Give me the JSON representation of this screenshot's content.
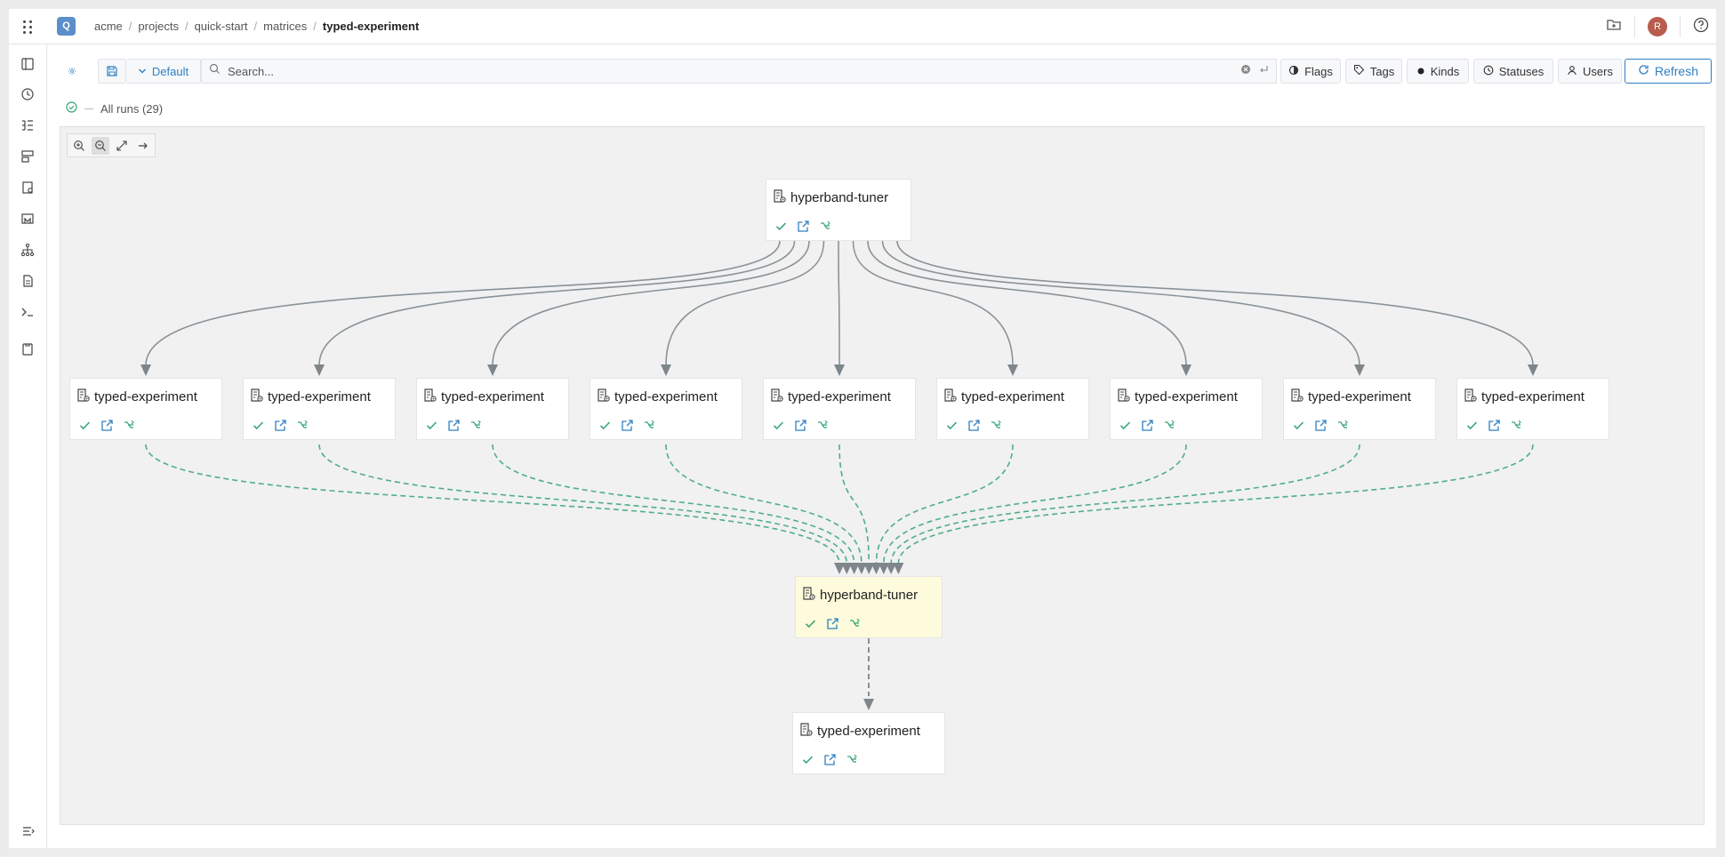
{
  "topbar": {
    "logo_letter": "Q",
    "avatar_letter": "R",
    "breadcrumb": [
      "acme",
      "projects",
      "quick-start",
      "matrices",
      "typed-experiment"
    ]
  },
  "toolbar": {
    "preset_label": "Default",
    "search_placeholder": "Search...",
    "filters": [
      "Flags",
      "Tags",
      "Kinds",
      "Statuses",
      "Users"
    ],
    "refresh_label": "Refresh"
  },
  "runs": {
    "label": "All runs (29)"
  },
  "graph": {
    "parent": {
      "name": "hyperband-tuner",
      "status": "succeeded"
    },
    "children": [
      {
        "name": "typed-experiment",
        "status": "succeeded"
      },
      {
        "name": "typed-experiment",
        "status": "succeeded"
      },
      {
        "name": "typed-experiment",
        "status": "succeeded"
      },
      {
        "name": "typed-experiment",
        "status": "succeeded"
      },
      {
        "name": "typed-experiment",
        "status": "succeeded"
      },
      {
        "name": "typed-experiment",
        "status": "succeeded"
      },
      {
        "name": "typed-experiment",
        "status": "succeeded"
      },
      {
        "name": "typed-experiment",
        "status": "succeeded"
      },
      {
        "name": "typed-experiment",
        "status": "succeeded"
      }
    ],
    "current": {
      "name": "hyperband-tuner",
      "status": "succeeded"
    },
    "last": {
      "name": "typed-experiment",
      "status": "succeeded"
    }
  },
  "colors": {
    "accent": "#2f7fc2",
    "success": "#3aa675",
    "edge": "#8a9399",
    "dashed_edge": "#4fae86",
    "highlight": "#fdfbdc"
  }
}
